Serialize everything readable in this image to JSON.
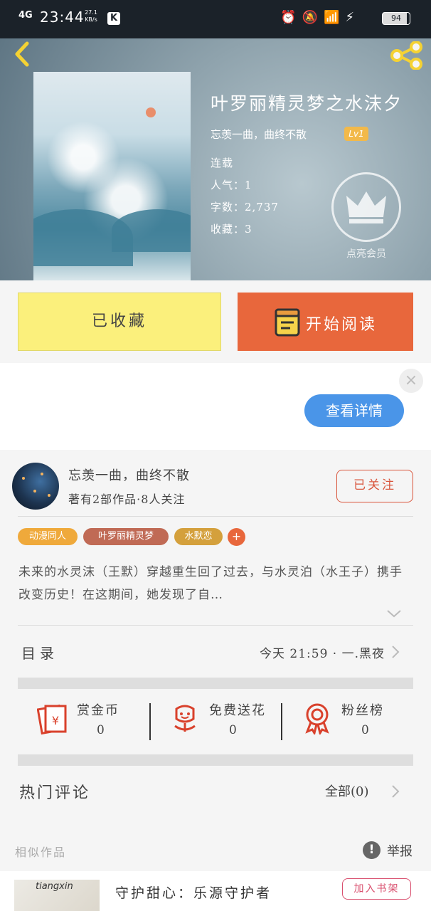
{
  "status_bar": {
    "network": "4G",
    "time": "23:44",
    "speed_value": "27.1",
    "speed_unit": "KB/s",
    "app_badge": "K",
    "battery": "94"
  },
  "book": {
    "title": "叶罗丽精灵梦之水沫夕",
    "author": "忘羡一曲，曲终不散",
    "level": "Lv1",
    "status": "连载",
    "popularity": "人气：1",
    "word_count": "字数：2,737",
    "favorites": "收藏：3",
    "vip_label": "点亮会员"
  },
  "actions": {
    "collected_label": "已收藏",
    "read_label": "开始阅读"
  },
  "ad": {
    "close_glyph": "×",
    "details_label": "查看详情"
  },
  "author_card": {
    "name": "忘羡一曲，曲终不散",
    "stats": "著有2部作品·8人关注",
    "follow_label": "已关注"
  },
  "tags": [
    {
      "label": "动漫同人",
      "color": "#efa93b"
    },
    {
      "label": "叶罗丽精灵梦",
      "color": "#c06a55"
    },
    {
      "label": "水默恋",
      "color": "#d4a03c"
    }
  ],
  "tag_add": "+",
  "intro_text": "未来的水灵沫（王默）穿越重生回了过去，与水灵泊（水王子）携手改变历史！在这期间，她发现了自…",
  "toc": {
    "label": "目录",
    "latest": "今天 21:59 · 一.黑夜"
  },
  "gifts": [
    {
      "label": "赏金币",
      "value": "0",
      "icon": "red-envelope-icon"
    },
    {
      "label": "免费送花",
      "value": "0",
      "icon": "flower-icon"
    },
    {
      "label": "粉丝榜",
      "value": "0",
      "icon": "medal-icon"
    }
  ],
  "comments": {
    "label": "热门评论",
    "all_label": "全部(0)"
  },
  "similar_label": "相似作品",
  "report_label": "举报",
  "recommend": {
    "thumb_text": "tiangxin",
    "title": "守护甜心：乐源守护者",
    "add_shelf_label": "加入书架"
  },
  "colors": {
    "accent_orange": "#e8673c",
    "collect_yellow": "#fbf07c",
    "details_blue": "#4a95e8",
    "icon_red": "#d9412c"
  }
}
